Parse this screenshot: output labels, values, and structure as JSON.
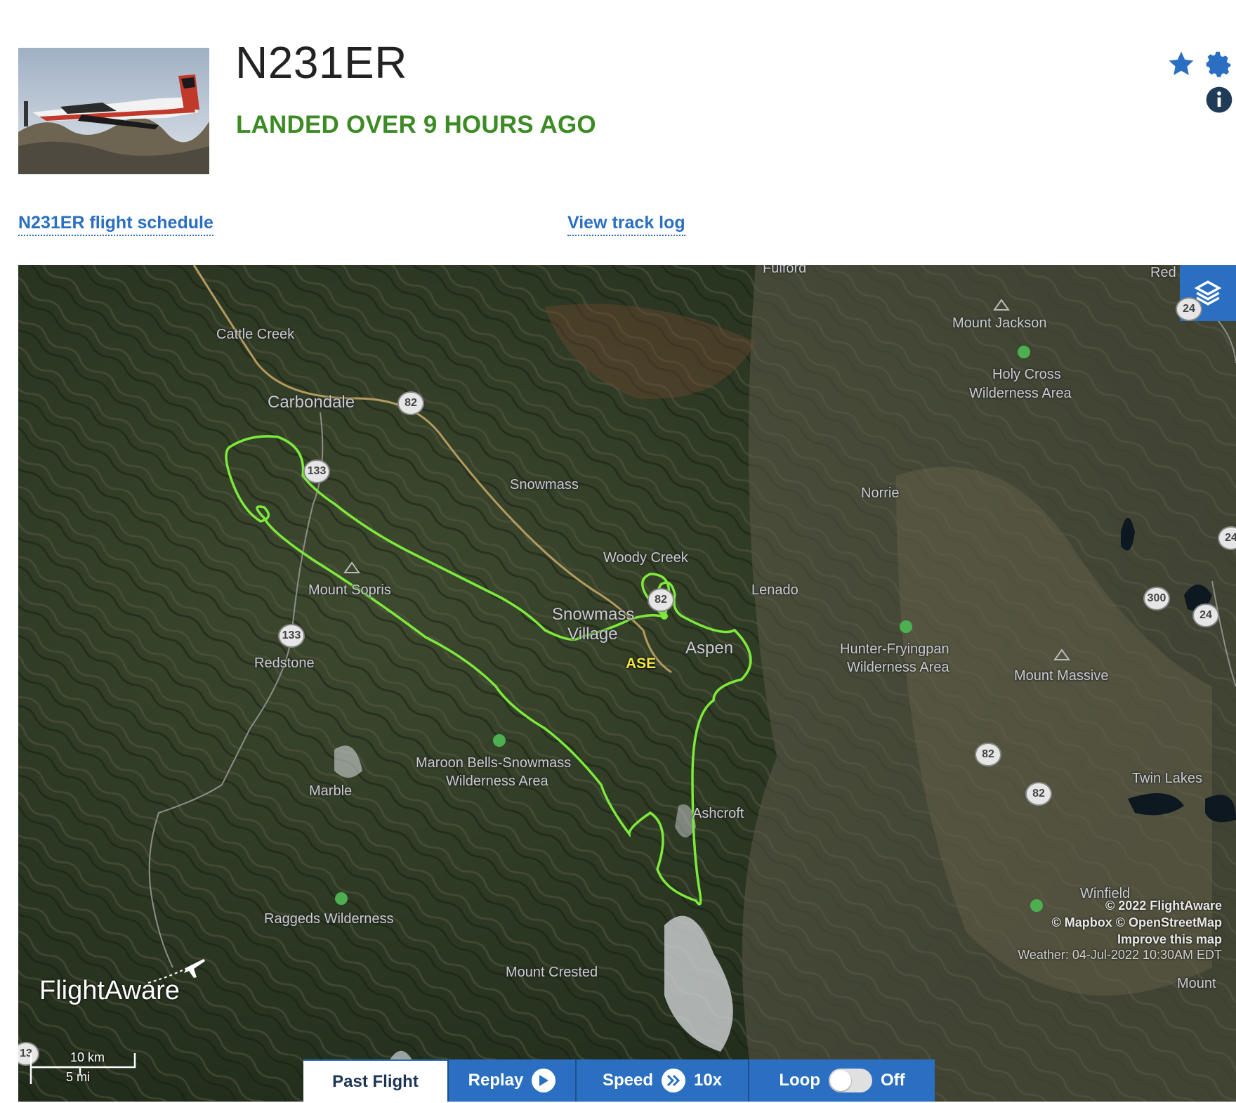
{
  "header": {
    "aircraft_photo_alt": "aircraft-photo",
    "tail_number": "N231ER",
    "status": "LANDED OVER 9 HOURS AGO"
  },
  "links": {
    "schedule": "N231ER flight schedule",
    "track_log": "View track log"
  },
  "icons": {
    "star": "star-icon",
    "settings": "gear-icon",
    "info": "info-icon",
    "layers": "layers-icon",
    "accent_color": "#2a6fc1",
    "status_color": "#3d8b25",
    "track_color": "#7dea3b"
  },
  "map": {
    "place_labels": [
      "Fulford",
      "Red",
      "Mount Jackson",
      "Holy Cross",
      "Wilderness Area",
      "Cattle Creek",
      "Carbondale",
      "Snowmass",
      "Norrie",
      "Woody Creek",
      "Mount Sopris",
      "Lenado",
      "Snowmass",
      "Village",
      "Aspen",
      "Hunter-Fryingpan",
      "Wilderness Area",
      "Mount Massive",
      "Redstone",
      "Maroon Bells-Snowmass",
      "Wilderness Area",
      "Marble",
      "Ashcroft",
      "Twin Lakes",
      "Winfield",
      "Raggeds Wilderness",
      "Mount Crested",
      "Mount"
    ],
    "route_shields": [
      "82",
      "133",
      "133",
      "82",
      "82",
      "82",
      "300",
      "24",
      "24",
      "24",
      "13"
    ],
    "airport_code": "ASE",
    "attribution": {
      "copyright": "© 2022 FlightAware",
      "tiles": "© Mapbox © OpenStreetMap",
      "improve": "Improve this map",
      "weather": "Weather: 04-Jul-2022 10:30AM EDT"
    },
    "logo": "FlightAware",
    "scale_km": "10 km",
    "scale_mi": "5 mi"
  },
  "controls": {
    "past_flight": "Past Flight",
    "replay": "Replay",
    "speed_label": "Speed",
    "speed_value": "10x",
    "loop_label": "Loop",
    "loop_value": "Off"
  }
}
